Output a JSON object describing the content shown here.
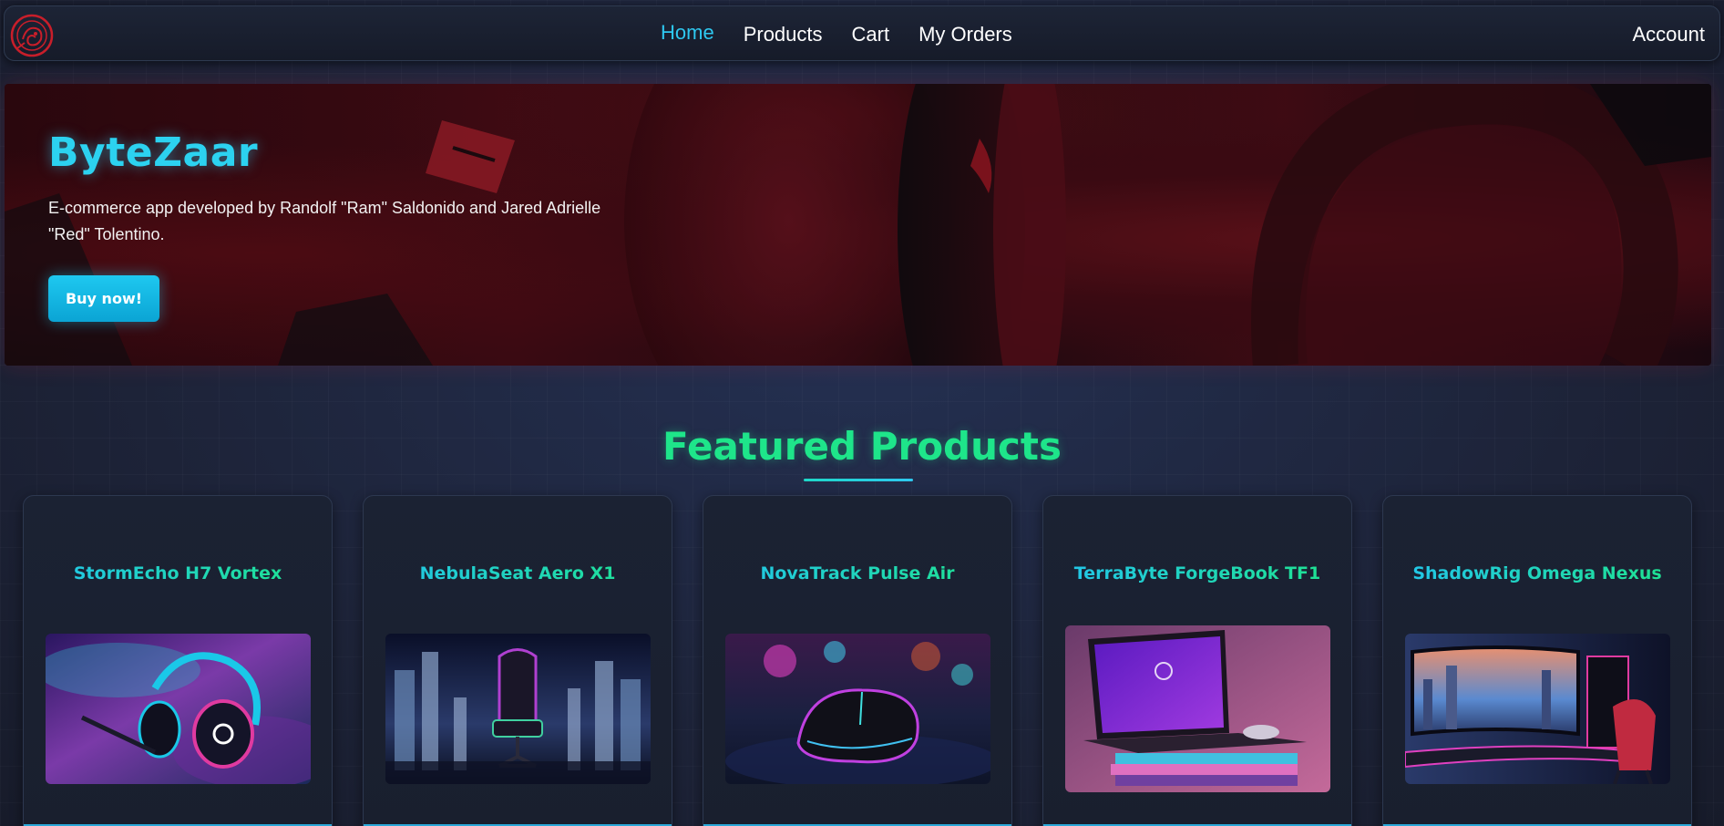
{
  "nav": {
    "links": [
      "Home",
      "Products",
      "Cart",
      "My Orders"
    ],
    "active": "Home",
    "account": "Account",
    "logo_icon": "dragon-logo-icon"
  },
  "hero": {
    "title": "ByteZaar",
    "description": "E-commerce app developed by Randolf \"Ram\" Saldonido and Jared Adrielle \"Red\" Tolentino.",
    "button": "Buy now!"
  },
  "featured": {
    "heading": "Featured Products",
    "products": [
      {
        "name": "StormEcho H7 Vortex",
        "image": "headset-image"
      },
      {
        "name": "NebulaSeat Aero X1",
        "image": "gaming-chair-image"
      },
      {
        "name": "NovaTrack Pulse Air",
        "image": "gaming-mouse-image"
      },
      {
        "name": "TerraByte ForgeBook TF1",
        "image": "laptop-image"
      },
      {
        "name": "ShadowRig Omega Nexus",
        "image": "gaming-setup-image"
      }
    ]
  },
  "colors": {
    "accent_cyan": "#2ec8f0",
    "accent_green": "#1ee58a",
    "background": "#1c2236",
    "hero_red": "#3a0a12"
  }
}
